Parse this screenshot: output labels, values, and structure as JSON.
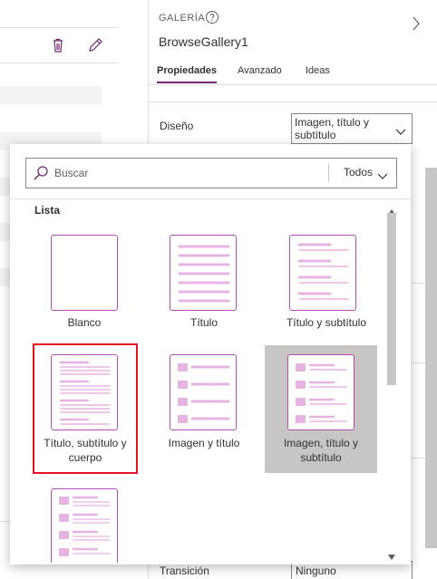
{
  "panel": {
    "control_type": "GALERÍA",
    "control_name": "BrowseGallery1",
    "tabs": [
      {
        "label": "Propiedades",
        "active": true
      },
      {
        "label": "Avanzado",
        "active": false
      },
      {
        "label": "Ideas",
        "active": false
      }
    ],
    "design_label": "Diseño",
    "design_value": "Imagen, título y subtítulo",
    "transition_label": "Transición",
    "transition_value": "Ninguno"
  },
  "flyout": {
    "search_placeholder": "Buscar",
    "filter_value": "Todos",
    "section_title": "Lista",
    "layouts": [
      {
        "label": "Blanco",
        "selected": false,
        "highlighted": false
      },
      {
        "label": "Título",
        "selected": false,
        "highlighted": false
      },
      {
        "label": "Título y subtítulo",
        "selected": false,
        "highlighted": false
      },
      {
        "label": "Título, subtítulo y cuerpo",
        "selected": false,
        "highlighted": true
      },
      {
        "label": "Imagen y título",
        "selected": false,
        "highlighted": false
      },
      {
        "label": "Imagen, título y subtítulo",
        "selected": true,
        "highlighted": false
      },
      {
        "label": "",
        "selected": false,
        "highlighted": false
      }
    ]
  },
  "colors": {
    "accent": "#742774",
    "thumb_border": "#b34bb0",
    "thumb_line": "#e7b3e3",
    "highlight": "#e81123",
    "selected_bg": "#c8c6c4"
  },
  "icons": [
    "trash-icon",
    "edit-icon",
    "help-icon",
    "chevron-right-icon",
    "chevron-down-icon",
    "search-icon"
  ]
}
